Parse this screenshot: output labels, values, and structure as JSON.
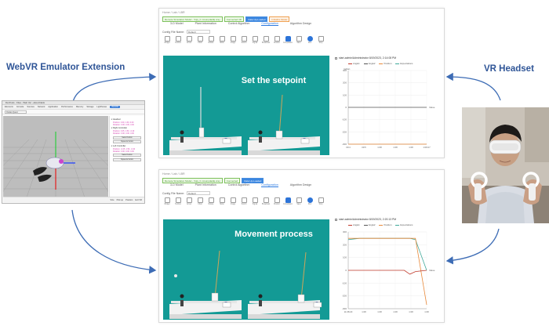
{
  "labels": {
    "left": "WebVR Emulator Extension",
    "right": "VR Headset"
  },
  "emulator": {
    "window_title": "DevTools - Files - Web Ver - about:blank",
    "tabs": [
      "Elements",
      "Console",
      "Sources",
      "Network",
      "Application",
      "Performance",
      "Memory",
      "Storage",
      "Lighthouse",
      "WebXR"
    ],
    "active_tab": "WebXR",
    "device_select": "Oculus Quest",
    "panel_headers": [
      "Headset",
      "Right Controller",
      "Left Controller"
    ],
    "panel_values": [
      "Position: 0.00, 1.60, 0.00",
      "Rotation: 0.00, 0.00, 0.00",
      "Position: 0.25, 1.50, -0.40",
      "Rotation: 0.00, 0.00, 0.00",
      "Position: -0.25, 1.50, -0.40",
      "Rotation: 0.00, 0.00, 0.00"
    ],
    "panel_buttons": [
      "Select button",
      "Squeeze button",
      "Select button",
      "Squeeze button"
    ],
    "status": [
      "Size",
      "Pick up",
      "Position",
      "Exit VR"
    ]
  },
  "apps": [
    {
      "id": "top",
      "breadcrumb": "Home  /  Lab  /  LBR",
      "tags": [
        {
          "text": "Remote Simulation Model - Vqty_b ncsunpdadlq.xray",
          "kind": "g"
        },
        {
          "text": "Connected OK",
          "kind": "g"
        },
        {
          "text": "Data Up-Loaded",
          "kind": "b"
        },
        {
          "text": "Initialize Model",
          "kind": "o"
        }
      ],
      "subtabs": [
        "3-D Model",
        "Plant Information",
        "Control Algorithm",
        "Configuration",
        "Algorithm Design"
      ],
      "active_subtab": "Configuration",
      "config_label": "Config File Name:",
      "config_value": "Default",
      "toolbar": [
        "Widget",
        "Textbox",
        "Arrow",
        "Chart",
        "Rotate",
        "Slider",
        "Image",
        "Switch",
        "Signal",
        "Broadcast",
        "Monitor",
        "Compilation",
        "Save",
        "Run",
        "Stop"
      ],
      "scene_title": "Set the setpoint",
      "chart_header": "start-admin/Administrator 8/19/2023, 2:14:08 PM",
      "legend": [
        "Angle1",
        "Angle2",
        "Position",
        "Expectations"
      ],
      "ylabel": "radian",
      "readout": "Value"
    },
    {
      "id": "bot",
      "breadcrumb": "Home  /  Lab  /  LBR",
      "tags": [
        {
          "text": "Remote Simulation Model - Vqty_b ncsunpdadlq.xray",
          "kind": "g"
        },
        {
          "text": "Connected",
          "kind": "g"
        },
        {
          "text": "Data Up-Loaded",
          "kind": "b"
        }
      ],
      "subtabs": [
        "3-D Model",
        "Plant Information",
        "Control Algorithm",
        "Configuration",
        "Algorithm Design"
      ],
      "active_subtab": "Configuration",
      "config_label": "Config File Name:",
      "config_value": "Default",
      "toolbar": [
        "Widget",
        "Textbox",
        "Arrow",
        "Chart",
        "Rotate",
        "Slider",
        "Image",
        "Switch",
        "Signal",
        "Broadcast",
        "Monitor",
        "Compilation",
        "Save",
        "Run",
        "Stop"
      ],
      "scene_title": "Movement process",
      "chart_header": "start-admin/Administrator 8/19/2023, 2:20:13 PM",
      "legend": [
        "Angle1",
        "Angle2",
        "Position",
        "Expectations"
      ],
      "ylabel": "",
      "readout": "Value"
    }
  ],
  "chart_data": [
    {
      "type": "line",
      "x": [
        0,
        1,
        2,
        3,
        4,
        5
      ],
      "x_tick_labels": [
        "09:4",
        "09:5",
        "1:08",
        "1:08",
        "1:08",
        "1:08:27"
      ],
      "ylim": [
        -300,
        300
      ],
      "y_ticks": [
        300,
        200,
        100,
        0,
        -100,
        -200,
        -300
      ],
      "series": [
        {
          "name": "Angle1",
          "values": [
            0,
            0,
            0,
            0,
            0,
            0
          ],
          "color": "#555555"
        },
        {
          "name": "Position",
          "values": [
            -300,
            -300,
            -300,
            -300,
            -300,
            -300
          ],
          "color": "#e8893a"
        }
      ],
      "grid": true
    },
    {
      "type": "line",
      "x": [
        0,
        1,
        2,
        3,
        4,
        5,
        5.5,
        6,
        7
      ],
      "x_tick_labels": [
        "11:08:20",
        "1:08",
        "1:08",
        "1:08",
        "1:08",
        "1:08"
      ],
      "ylim": [
        -300,
        300
      ],
      "y_ticks": [
        300,
        200,
        100,
        0,
        -100,
        -200,
        -300
      ],
      "series": [
        {
          "name": "Angle2",
          "values": [
            240,
            250,
            250,
            250,
            250,
            250,
            250,
            240,
            0
          ],
          "color": "#3fa89a"
        },
        {
          "name": "Position",
          "values": [
            250,
            250,
            250,
            250,
            250,
            250,
            250,
            250,
            -270
          ],
          "color": "#e8893a"
        },
        {
          "name": "Angle1",
          "values": [
            0,
            0,
            0,
            0,
            0,
            0,
            -30,
            -10,
            0
          ],
          "color": "#c0392b"
        }
      ],
      "grid": true
    }
  ]
}
